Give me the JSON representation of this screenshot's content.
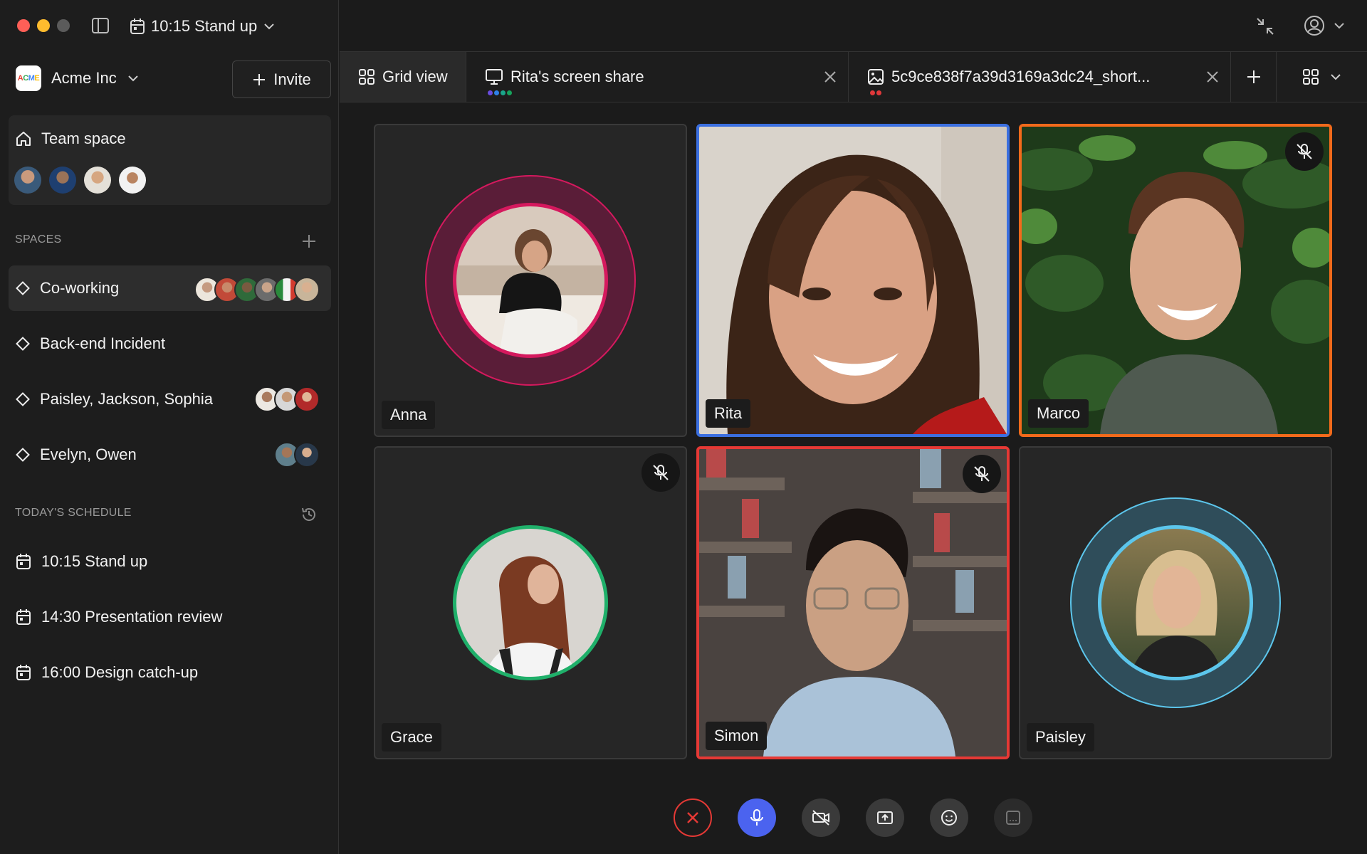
{
  "window": {
    "meeting_title": "10:15 Stand up"
  },
  "sidebar": {
    "org": {
      "logo_text": [
        "A",
        "C",
        "M",
        "E"
      ],
      "name": "Acme Inc"
    },
    "invite_label": "Invite",
    "team_space": {
      "label": "Team space"
    },
    "spaces_header": "SPACES",
    "spaces": [
      {
        "label": "Co-working"
      },
      {
        "label": "Back-end Incident"
      },
      {
        "label": "Paisley, Jackson, Sophia"
      },
      {
        "label": "Evelyn, Owen"
      }
    ],
    "schedule_header": "TODAY'S SCHEDULE",
    "schedule": [
      {
        "label": "10:15 Stand up"
      },
      {
        "label": "14:30 Presentation review"
      },
      {
        "label": "16:00 Design catch-up"
      }
    ]
  },
  "tabs": [
    {
      "label": "Grid view"
    },
    {
      "label": "Rita's screen share"
    },
    {
      "label": "5c9ce838f7a39d3169a3dc24_short..."
    }
  ],
  "participants": [
    {
      "name": "Anna",
      "muted": false,
      "status_color": "#d5195e"
    },
    {
      "name": "Rita",
      "muted": false,
      "status_color": "#3b6fe0"
    },
    {
      "name": "Marco",
      "muted": true,
      "status_color": "#f26a1b"
    },
    {
      "name": "Grace",
      "muted": true,
      "status_color": "#1fb06a"
    },
    {
      "name": "Simon",
      "muted": true,
      "status_color": "#e53935"
    },
    {
      "name": "Paisley",
      "muted": false,
      "status_color": "#5cc6ec"
    }
  ],
  "colors": {
    "accent": "#4b63ef",
    "leave": "#e53935"
  }
}
